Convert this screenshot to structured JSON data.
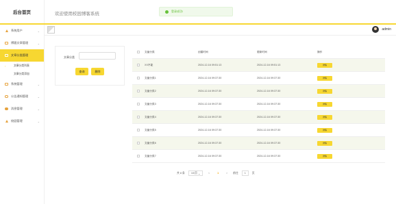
{
  "header": {
    "brand": "后台首页",
    "welcome": "欢迎使用校园博客系统",
    "toast": "登录成功!"
  },
  "user": {
    "name": "admin"
  },
  "sidebar": {
    "items": [
      {
        "label": "系统用户",
        "icon": "person-icon"
      },
      {
        "label": "博客文章管理",
        "icon": "square-icon"
      },
      {
        "label": "文章分类管理",
        "icon": "square-icon",
        "active": true
      },
      {
        "label": "系统管理",
        "icon": "square-icon"
      },
      {
        "label": "公告通知管理",
        "icon": "circle-icon"
      },
      {
        "label": "消息管理",
        "icon": "circle-fill-icon"
      },
      {
        "label": "校园管理",
        "icon": "person-icon"
      }
    ],
    "sub_items": [
      {
        "label": "文章分类列表"
      },
      {
        "label": "文章分类添加"
      }
    ]
  },
  "search": {
    "label": "文章分类",
    "placeholder": "",
    "search_btn": "查询",
    "reset_btn": "删除"
  },
  "table": {
    "headers": [
      "文章分类",
      "创建时间",
      "更新时间",
      "操作"
    ],
    "detail_label": "详情",
    "rows": [
      [
        "XX不能",
        "2024-12-16 09:51:13",
        "2024-12-16 09:51:13"
      ],
      [
        "文章分类1",
        "2024-12-16 09:37:30",
        "2024-12-16 09:37:30"
      ],
      [
        "文章分类2",
        "2024-12-16 09:37:30",
        "2024-12-16 09:37:30"
      ],
      [
        "文章分类3",
        "2024-12-16 09:37:30",
        "2024-12-16 09:37:30"
      ],
      [
        "文章分类4",
        "2024-12-16 09:37:30",
        "2024-12-16 09:37:30"
      ],
      [
        "文章分类5",
        "2024-12-16 09:37:30",
        "2024-12-16 09:37:30"
      ],
      [
        "文章分类6",
        "2024-12-16 09:37:30",
        "2024-12-16 09:37:30"
      ],
      [
        "文章分类7",
        "2024-12-16 09:37:30",
        "2024-12-16 09:37:30"
      ]
    ]
  },
  "pagination": {
    "total": "共 8 条",
    "page_size": "10/页",
    "prev": "<",
    "current": "1",
    "next": ">",
    "goto": "前往",
    "goto_value": "1",
    "page_unit": "页"
  },
  "colors": {
    "accent": "#f7d731",
    "stripe": "#f5f7ec",
    "toast_bg": "#f0f9eb",
    "toast_text": "#67c23a"
  }
}
